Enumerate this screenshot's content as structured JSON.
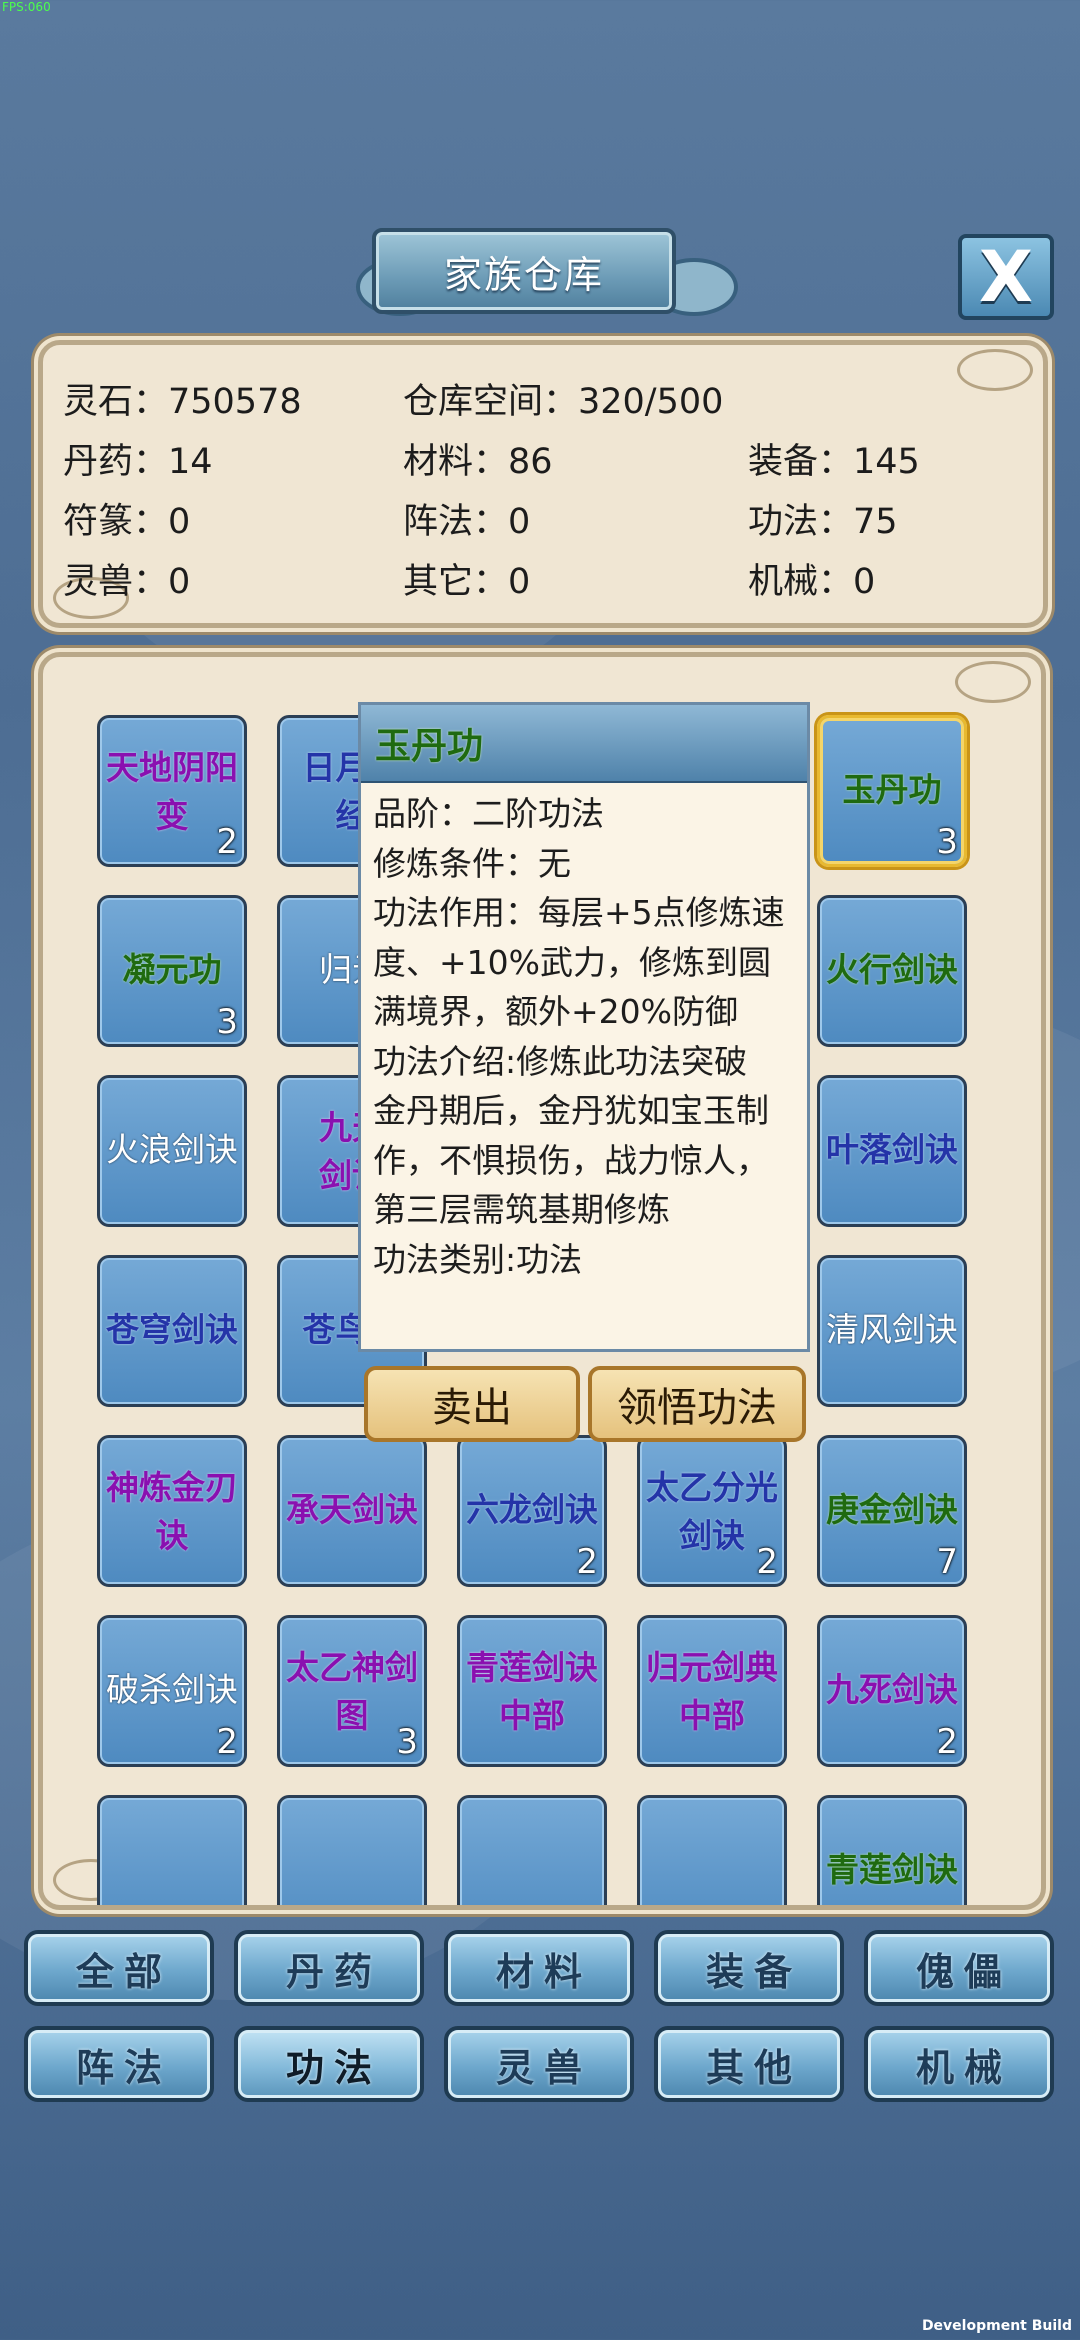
{
  "debug": {
    "fps": "FPS:060",
    "build": "Development Build"
  },
  "title": "家族仓库",
  "close_label": "X",
  "stats": {
    "spirit_stone": "灵石：750578",
    "space": "仓库空间：320/500",
    "pills": "丹药：14",
    "materials": "材料：86",
    "equipment": "装备：145",
    "talismans": "符篆：0",
    "formations": "阵法：0",
    "techniques": "功法：75",
    "beasts": "灵兽：0",
    "others": "其它：0",
    "machinery": "机械：0"
  },
  "items": [
    {
      "name": "天地阴阳变",
      "lines": [
        "天地阴阳",
        "变"
      ],
      "count": "2",
      "quality": "purple"
    },
    {
      "name": "日月轮经",
      "lines": [
        "日月轮",
        "经"
      ],
      "count": "",
      "quality": "blue"
    },
    {
      "name": "玉丹功",
      "lines": [
        "玉丹功"
      ],
      "count": "3",
      "quality": "green",
      "selected": true
    },
    {
      "name": "凝元功",
      "lines": [
        "凝元功"
      ],
      "count": "3",
      "quality": "green"
    },
    {
      "name": "归元",
      "lines": [
        "归元"
      ],
      "count": "",
      "quality": "white"
    },
    {
      "name": "火行剑诀",
      "lines": [
        "火行剑诀"
      ],
      "count": "",
      "quality": "green"
    },
    {
      "name": "火浪剑诀",
      "lines": [
        "火浪剑诀"
      ],
      "count": "",
      "quality": "white"
    },
    {
      "name": "九天剑诀",
      "lines": [
        "九天",
        "剑诀"
      ],
      "count": "",
      "quality": "purple"
    },
    {
      "name": "叶落剑诀",
      "lines": [
        "叶落剑诀"
      ],
      "count": "",
      "quality": "blue"
    },
    {
      "name": "苍穹剑诀",
      "lines": [
        "苍穹剑诀"
      ],
      "count": "",
      "quality": "blue"
    },
    {
      "name": "苍鸟剑诀",
      "lines": [
        "苍鸟剑"
      ],
      "count": "",
      "quality": "blue"
    },
    {
      "name": "清风剑诀",
      "lines": [
        "清风剑诀"
      ],
      "count": "",
      "quality": "white"
    },
    {
      "name": "神炼金刃诀",
      "lines": [
        "神炼金刃",
        "诀"
      ],
      "count": "",
      "quality": "purple"
    },
    {
      "name": "承天剑诀",
      "lines": [
        "承天剑诀"
      ],
      "count": "",
      "quality": "purple"
    },
    {
      "name": "六龙剑诀",
      "lines": [
        "六龙剑诀"
      ],
      "count": "2",
      "quality": "blue"
    },
    {
      "name": "太乙分光剑诀",
      "lines": [
        "太乙分光",
        "剑诀"
      ],
      "count": "2",
      "quality": "blue"
    },
    {
      "name": "庚金剑诀",
      "lines": [
        "庚金剑诀"
      ],
      "count": "7",
      "quality": "green"
    },
    {
      "name": "破杀剑诀",
      "lines": [
        "破杀剑诀"
      ],
      "count": "2",
      "quality": "white"
    },
    {
      "name": "太乙神剑图",
      "lines": [
        "太乙神剑",
        "图"
      ],
      "count": "3",
      "quality": "purple"
    },
    {
      "name": "青莲剑诀中部",
      "lines": [
        "青莲剑诀",
        "中部"
      ],
      "count": "",
      "quality": "purple"
    },
    {
      "name": "归元剑典中部",
      "lines": [
        "归元剑典",
        "中部"
      ],
      "count": "",
      "quality": "purple"
    },
    {
      "name": "九死剑诀",
      "lines": [
        "九死剑诀"
      ],
      "count": "2",
      "quality": "purple"
    },
    {
      "name": "",
      "lines": [],
      "count": "",
      "quality": "white"
    },
    {
      "name": "",
      "lines": [],
      "count": "",
      "quality": "white"
    },
    {
      "name": "",
      "lines": [],
      "count": "",
      "quality": "white"
    },
    {
      "name": "",
      "lines": [],
      "count": "",
      "quality": "white"
    },
    {
      "name": "青莲剑诀",
      "lines": [
        "青莲剑诀"
      ],
      "count": "",
      "quality": "green"
    }
  ],
  "tooltip": {
    "title": "玉丹功",
    "lines": [
      "品阶：二阶功法",
      "修炼条件：无",
      "功法作用：每层+5点修炼速",
      "度、+10%武力，修炼到圆",
      "满境界，额外+20%防御",
      "功法介绍:修炼此功法突破",
      "金丹期后，金丹犹如宝玉制",
      "作，不惧损伤，战力惊人，",
      "第三层需筑基期修炼",
      "功法类别:功法"
    ]
  },
  "actions": {
    "sell": "卖出",
    "comprehend": "领悟功法"
  },
  "tabs": [
    {
      "label": "全部"
    },
    {
      "label": "丹药"
    },
    {
      "label": "材料"
    },
    {
      "label": "装备"
    },
    {
      "label": "傀儡"
    },
    {
      "label": "阵法"
    },
    {
      "label": "功法",
      "active": true
    },
    {
      "label": "灵兽"
    },
    {
      "label": "其他"
    },
    {
      "label": "机械"
    }
  ],
  "colors": {
    "parchment": "#f0e6d3",
    "tile_blue": "#5b93c6",
    "selected_gold": "#e8b930"
  }
}
